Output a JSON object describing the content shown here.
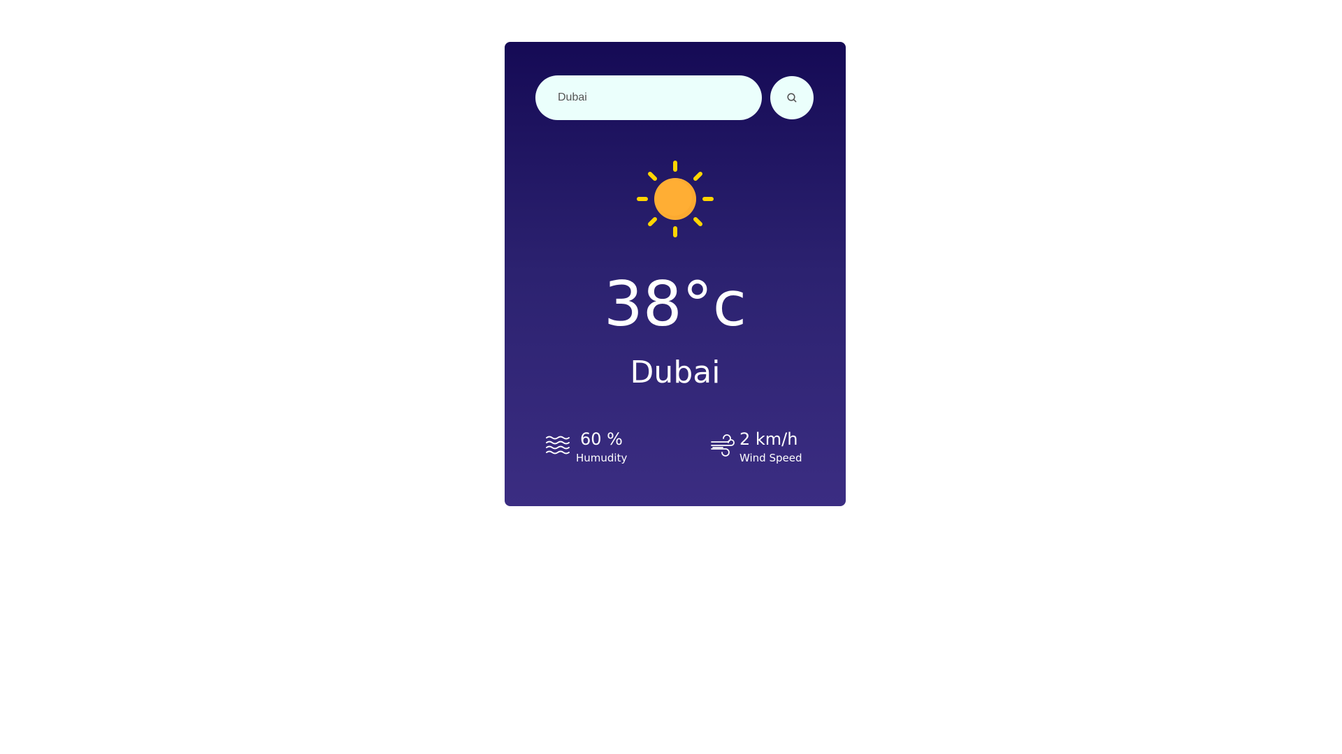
{
  "search": {
    "value": "Dubai",
    "button_icon": "search-icon"
  },
  "weather": {
    "icon": "sun-icon",
    "temperature": "38°c",
    "city": "Dubai"
  },
  "details": {
    "humidity": {
      "icon": "humidity-icon",
      "value": "60 %",
      "label": "Humudity"
    },
    "wind": {
      "icon": "wind-icon",
      "value": "2 km/h",
      "label": "Wind Speed"
    }
  },
  "colors": {
    "card_top": "#150a55",
    "card_bottom": "#3b2d82",
    "input_bg": "#ebfffc",
    "sun_core": "#ffae34",
    "sun_rays": "#ffd500",
    "text": "#ffffff"
  }
}
